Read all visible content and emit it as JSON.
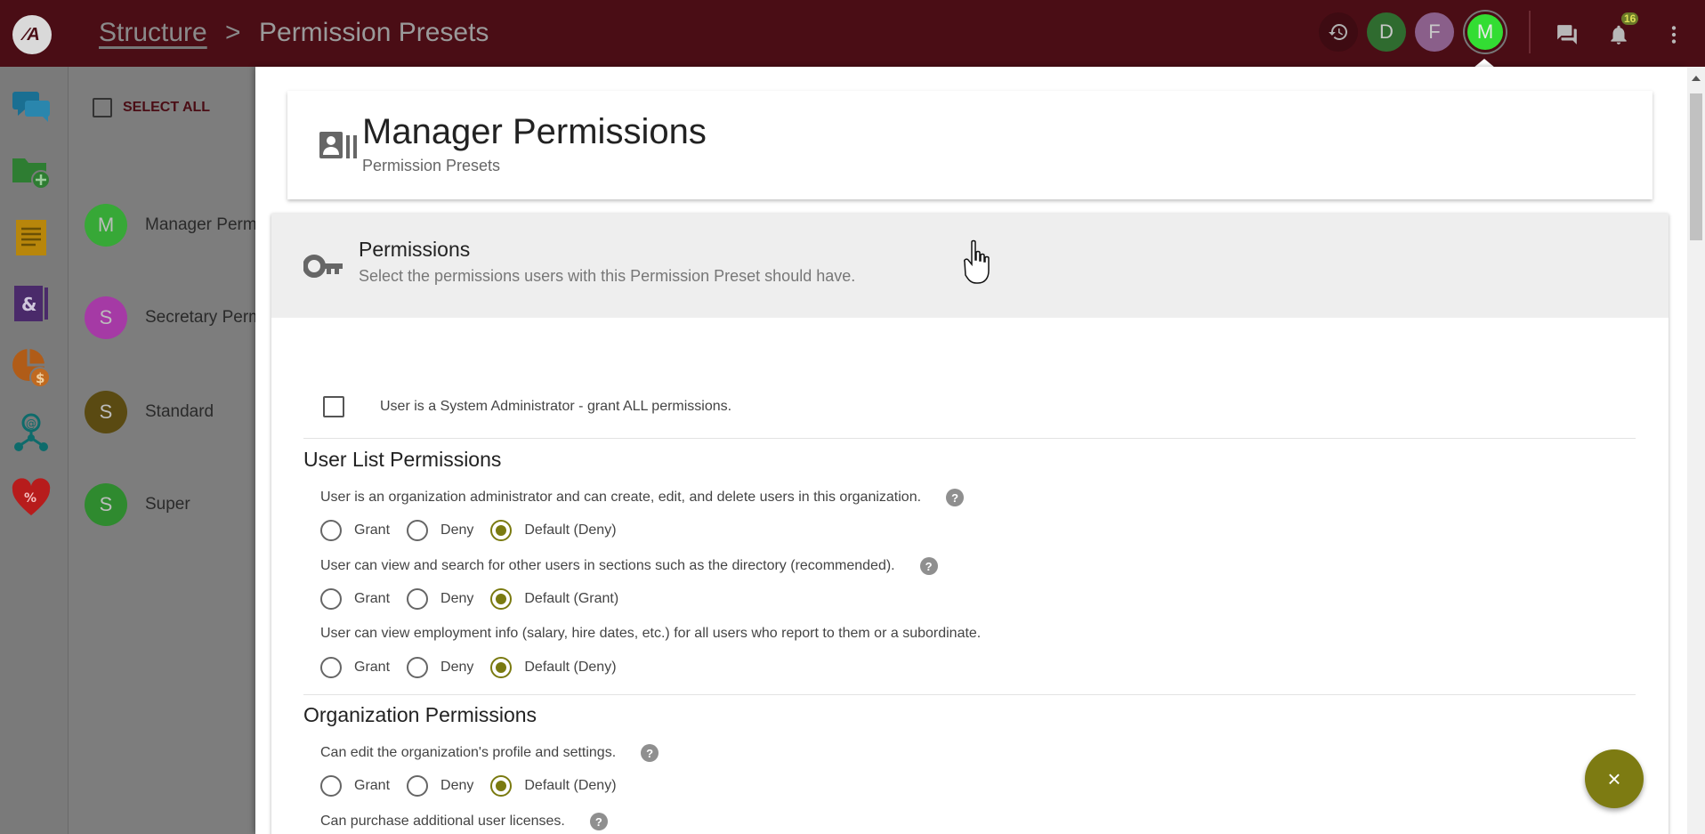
{
  "topbar": {
    "logo_text": "∕A",
    "breadcrumb": [
      "Structure",
      "Permission Presets"
    ],
    "breadcrumb_separator": ">",
    "avatars": [
      {
        "letter": "D",
        "color": "#2f6b2f"
      },
      {
        "letter": "F",
        "color": "#8a5f8a"
      },
      {
        "letter": "M",
        "color": "#33dd33"
      }
    ],
    "notification_count": "16",
    "background": "#4a0d15"
  },
  "sidebar": {
    "icons": [
      "chat-icon",
      "folder-add-icon",
      "document-icon",
      "address-book-icon",
      "finance-icon",
      "network-icon",
      "health-icon"
    ]
  },
  "list": {
    "select_all_label": "SELECT ALL",
    "items": [
      {
        "letter": "M",
        "name": "Manager Perm",
        "color": "#37a837"
      },
      {
        "letter": "S",
        "name": "Secretary Perm",
        "color": "#a53aa5"
      },
      {
        "letter": "S",
        "name": "Standard",
        "color": "#5a4a12"
      },
      {
        "letter": "S",
        "name": "Super",
        "color": "#2f8a2f"
      }
    ]
  },
  "drawer": {
    "title": "Manager Permissions",
    "subtitle": "Permission Presets",
    "permissions_title": "Permissions",
    "permissions_subtitle": "Select the permissions users with this Permission Preset should have.",
    "sysadmin_label": "User is a System Administrator - grant ALL permissions.",
    "radio_labels": {
      "grant": "Grant",
      "deny": "Deny"
    },
    "sections": [
      {
        "title": "User List Permissions",
        "questions": [
          {
            "text": "User is an organization administrator and can create, edit, and delete users in this organization.",
            "help": true,
            "default_label": "Default (Deny)",
            "selected": "default"
          },
          {
            "text": "User can view and search for other users in sections such as the directory (recommended).",
            "help": true,
            "default_label": "Default (Grant)",
            "selected": "default"
          },
          {
            "text": "User can view employment info (salary, hire dates, etc.) for all users who report to them or a subordinate.",
            "help": false,
            "default_label": "Default (Deny)",
            "selected": "default"
          }
        ]
      },
      {
        "title": "Organization Permissions",
        "questions": [
          {
            "text": "Can edit the organization's profile and settings.",
            "help": true,
            "default_label": "Default (Deny)",
            "selected": "default"
          },
          {
            "text": "Can purchase additional user licenses.",
            "help": true
          }
        ]
      }
    ],
    "help_glyph": "?",
    "fab_label": "×",
    "accent_color": "#7a7a10"
  }
}
